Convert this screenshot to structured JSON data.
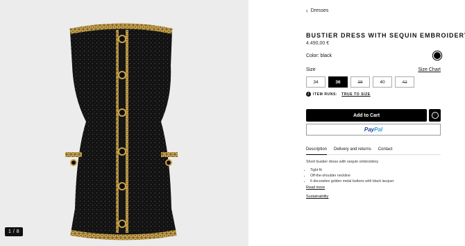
{
  "gallery": {
    "counter": "1 / 8",
    "image_alt": "black sequin bustier dress with golden chain trim"
  },
  "breadcrumb": {
    "label": "Dresses"
  },
  "product": {
    "title": "BUSTIER DRESS WITH SEQUIN EMBROIDERY",
    "price": "4.490,00 €"
  },
  "color": {
    "label": "Color: black",
    "swatch_hex": "#000000"
  },
  "size": {
    "label": "Size",
    "chart_link": "Size Chart",
    "options": [
      {
        "label": "34",
        "state": "available"
      },
      {
        "label": "36",
        "state": "selected"
      },
      {
        "label": "38",
        "state": "unavailable"
      },
      {
        "label": "40",
        "state": "available"
      },
      {
        "label": "42",
        "state": "unavailable"
      }
    ]
  },
  "fit": {
    "label": "ITEM RUNS:",
    "value": "TRUE TO SIZE"
  },
  "actions": {
    "add_to_cart": "Add to Cart",
    "paypal_a": "Pay",
    "paypal_b": "Pal"
  },
  "tabs": [
    "Description",
    "Delivery and returns",
    "Contact"
  ],
  "description": {
    "summary": "Short bustier dress with sequin embroidery",
    "bullets": [
      "Tight fit",
      "Off-the-shoulder neckline",
      "6 decorative golden metal buttons with black lacquer"
    ],
    "read_more": "Read more",
    "sustainability": "Sustainability"
  },
  "colors": {
    "accent": "#000000",
    "paypal_dark": "#1b3a8a",
    "paypal_light": "#2aa0e0",
    "gallery_bg": "#ececec"
  }
}
